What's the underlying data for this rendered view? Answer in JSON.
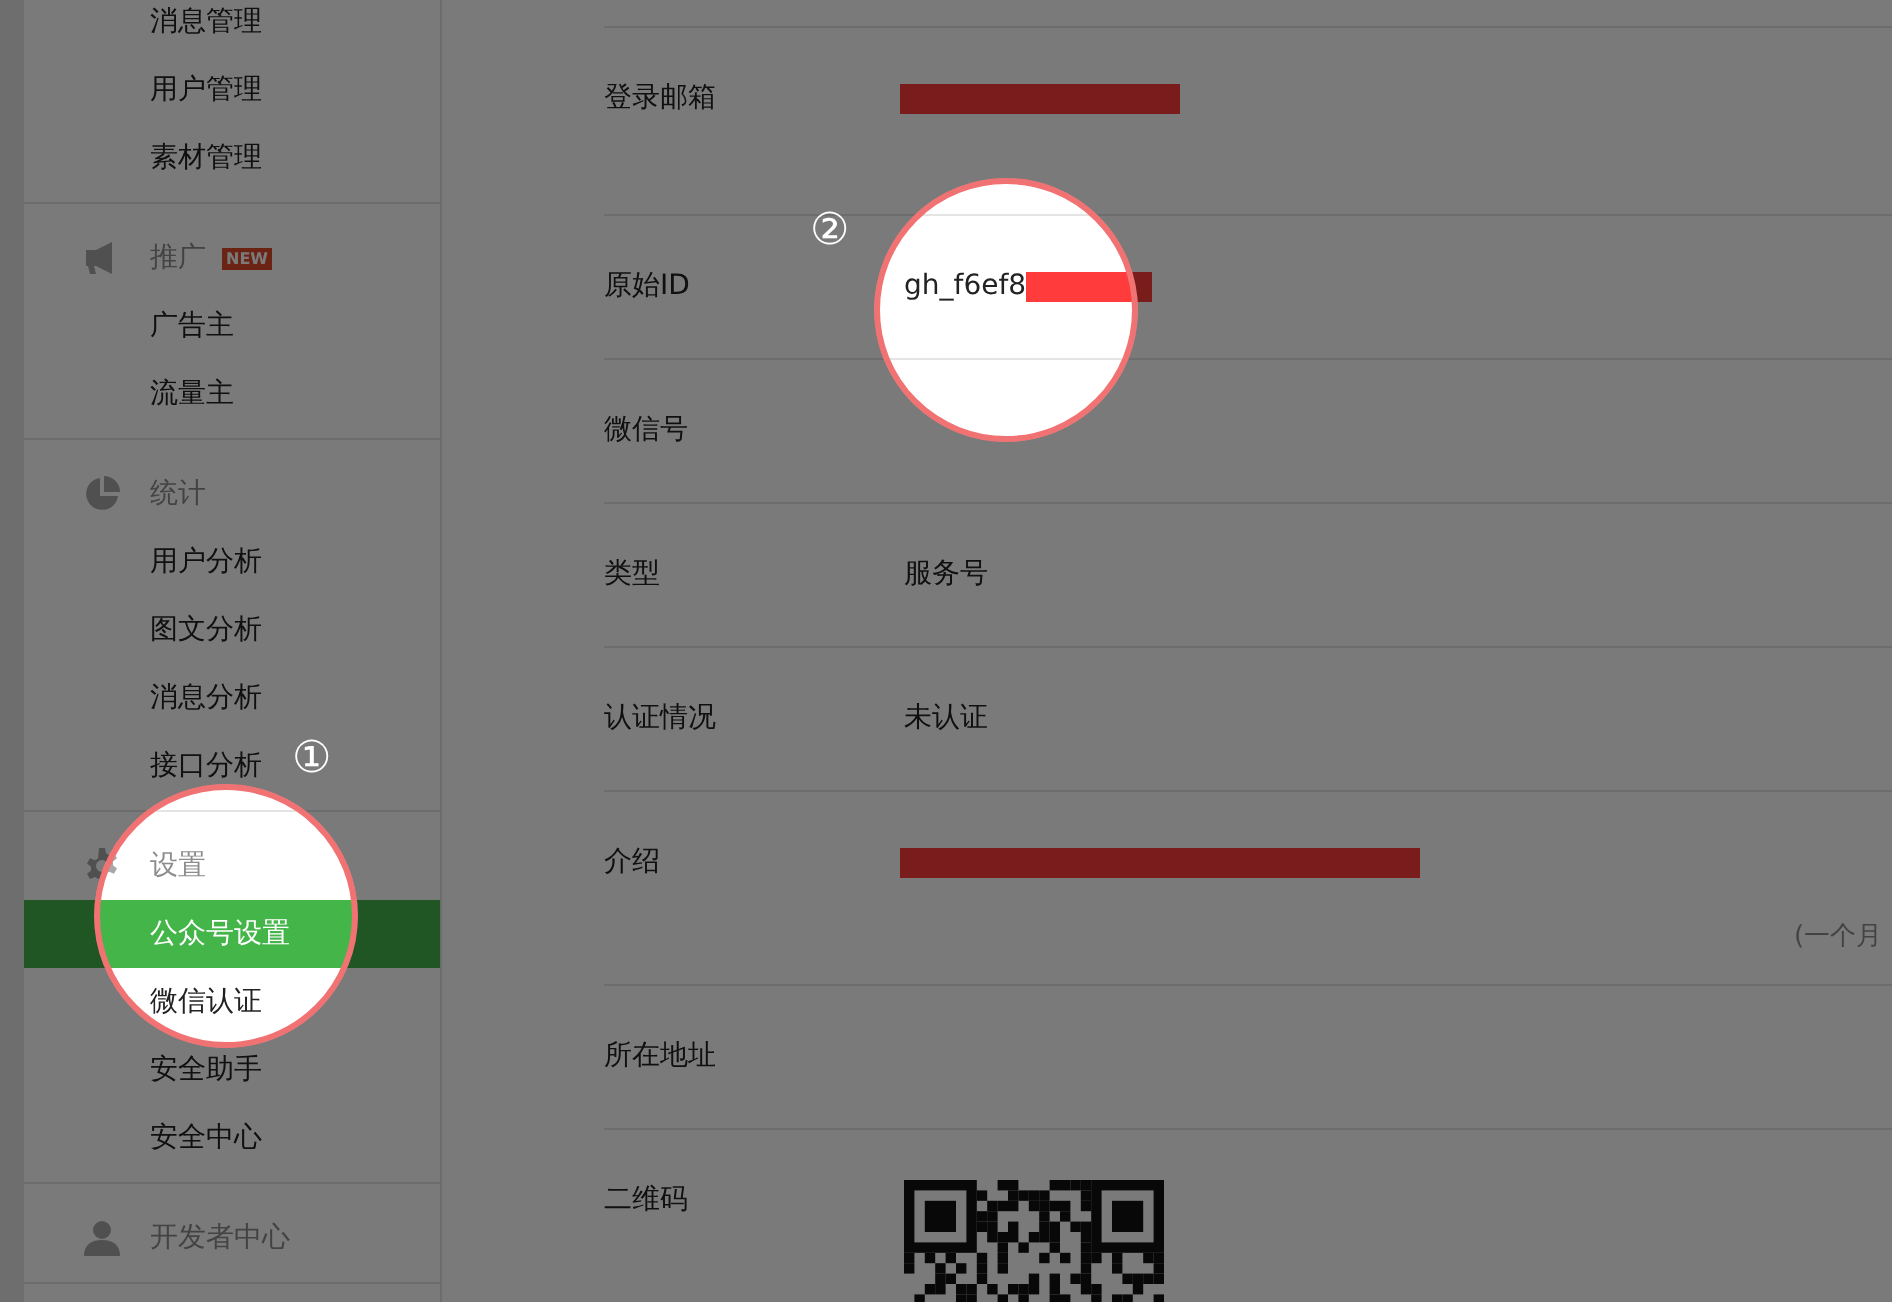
{
  "sidebar": {
    "groups": [
      {
        "items": [
          {
            "label": "消息管理",
            "selected": false
          },
          {
            "label": "用户管理",
            "selected": false
          },
          {
            "label": "素材管理",
            "selected": false
          }
        ]
      },
      {
        "header": {
          "label": "推广",
          "badge": "NEW"
        },
        "items": [
          {
            "label": "广告主",
            "selected": false
          },
          {
            "label": "流量主",
            "selected": false
          }
        ]
      },
      {
        "header": {
          "label": "统计"
        },
        "items": [
          {
            "label": "用户分析",
            "selected": false
          },
          {
            "label": "图文分析",
            "selected": false
          },
          {
            "label": "消息分析",
            "selected": false
          },
          {
            "label": "接口分析",
            "selected": false
          }
        ]
      },
      {
        "header": {
          "label": "设置"
        },
        "items": [
          {
            "label": "公众号设置",
            "selected": true
          },
          {
            "label": "微信认证",
            "selected": false
          },
          {
            "label": "安全助手",
            "selected": false
          },
          {
            "label": "安全中心",
            "selected": false
          }
        ]
      },
      {
        "header": {
          "label": "开发者中心"
        }
      }
    ]
  },
  "settings": {
    "rows": [
      {
        "kind": "text",
        "label": "登录邮箱",
        "redacted": true
      },
      {
        "kind": "text",
        "label": "原始ID",
        "value": "gh_f6ef8",
        "redacted": true
      },
      {
        "kind": "text",
        "label": "微信号"
      },
      {
        "kind": "text",
        "label": "类型",
        "value": "服务号"
      },
      {
        "kind": "text",
        "label": "认证情况",
        "value": "未认证"
      },
      {
        "kind": "text",
        "label": "介绍",
        "redacted": true,
        "note": "(一个月"
      },
      {
        "kind": "text",
        "label": "所在地址"
      },
      {
        "kind": "qr",
        "label": "二维码"
      }
    ]
  },
  "annotations": [
    {
      "text": "①"
    },
    {
      "text": "②"
    }
  ]
}
